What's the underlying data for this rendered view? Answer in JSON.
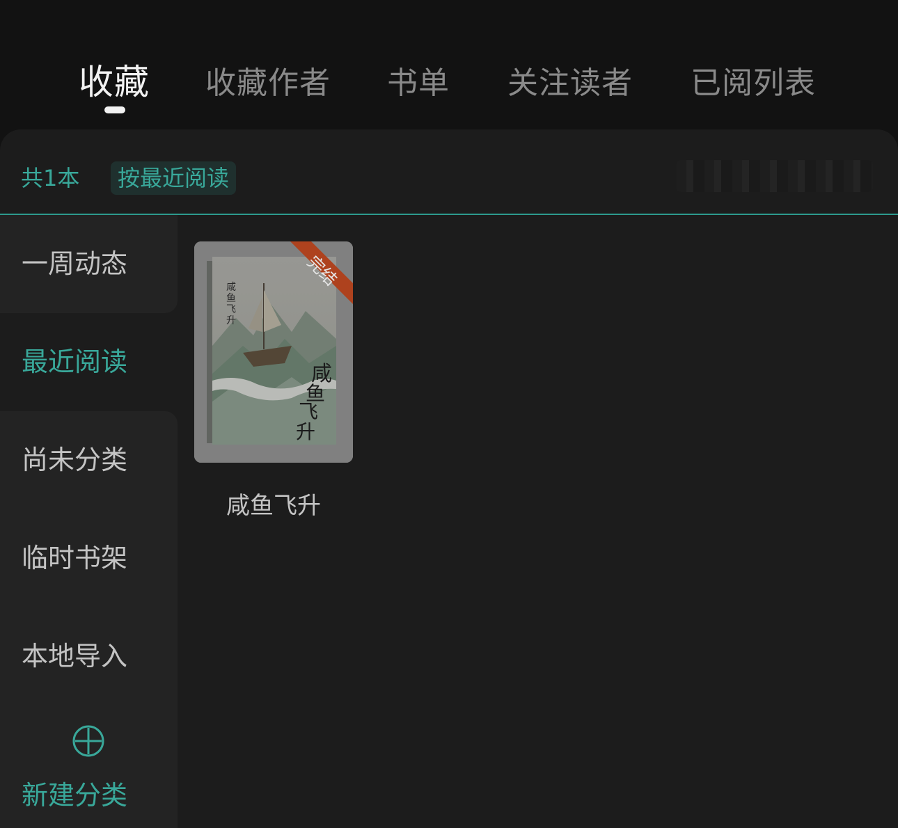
{
  "tabs": [
    {
      "label": "收藏",
      "active": true
    },
    {
      "label": "收藏作者"
    },
    {
      "label": "书单"
    },
    {
      "label": "关注读者"
    },
    {
      "label": "已阅列表"
    }
  ],
  "summary": {
    "count": "共1本",
    "sort": "按最近阅读"
  },
  "sidebar": {
    "items": [
      {
        "label": "一周动态"
      },
      {
        "label": "最近阅读",
        "active": true
      },
      {
        "label": "尚未分类"
      },
      {
        "label": "临时书架"
      },
      {
        "label": "本地导入"
      }
    ],
    "new_category": "新建分类"
  },
  "books": [
    {
      "title": "咸鱼飞升",
      "badge": "完结",
      "cover_title": "咸鱼飞升"
    }
  ],
  "colors": {
    "accent": "#39a89a",
    "badge": "#c24a22"
  }
}
